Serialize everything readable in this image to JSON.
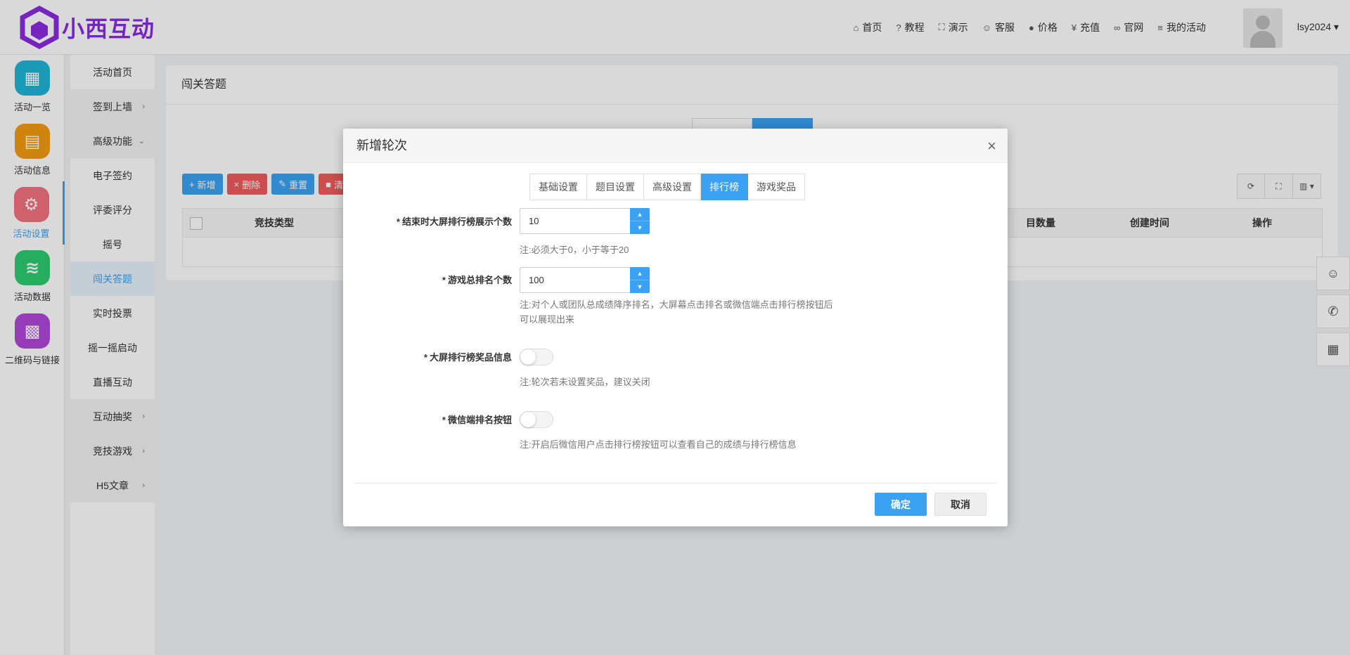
{
  "brand": {
    "name": "小西互动",
    "color": "#8a2be2"
  },
  "topnav": [
    {
      "icon": "⌂",
      "label": "首页",
      "icon_name": "home-icon"
    },
    {
      "icon": "?",
      "label": "教程",
      "icon_name": "help-icon"
    },
    {
      "icon": "⛶",
      "label": "演示",
      "icon_name": "fullscreen-icon"
    },
    {
      "icon": "☺",
      "label": "客服",
      "icon_name": "service-icon"
    },
    {
      "icon": "●",
      "label": "价格",
      "icon_name": "price-icon"
    },
    {
      "icon": "¥",
      "label": "充值",
      "icon_name": "yen-icon"
    },
    {
      "icon": "∞",
      "label": "官网",
      "icon_name": "link-icon"
    },
    {
      "icon": "≡",
      "label": "我的活动",
      "icon_name": "list-icon"
    }
  ],
  "user": {
    "name": "lsy2024 ▾"
  },
  "iconbar": [
    {
      "label": "活动一览",
      "color": "#1fb5d6",
      "glyph": "▦"
    },
    {
      "label": "活动信息",
      "color": "#f39c12",
      "glyph": "▤"
    },
    {
      "label": "活动设置",
      "color": "#f2727e",
      "glyph": "⚙"
    },
    {
      "label": "活动数据",
      "color": "#2ecc71",
      "glyph": "≋"
    },
    {
      "label": "二维码与链接",
      "color": "#b147d9",
      "glyph": "▩"
    }
  ],
  "submenu": [
    {
      "label": "活动首页",
      "chev": ""
    },
    {
      "label": "签到上墙",
      "chev": "›"
    },
    {
      "label": "高级功能",
      "chev": "⌄"
    },
    {
      "label": "电子签约",
      "chev": ""
    },
    {
      "label": "评委评分",
      "chev": ""
    },
    {
      "label": "摇号",
      "chev": ""
    },
    {
      "label": "闯关答题",
      "chev": ""
    },
    {
      "label": "实时投票",
      "chev": ""
    },
    {
      "label": "摇一摇启动",
      "chev": ""
    },
    {
      "label": "直播互动",
      "chev": ""
    },
    {
      "label": "互动抽奖",
      "chev": "›"
    },
    {
      "label": "竞技游戏",
      "chev": "›"
    },
    {
      "label": "H5文章",
      "chev": "›"
    }
  ],
  "card": {
    "title": "闯关答题",
    "toolbar": [
      {
        "label": "新增",
        "icon": "+",
        "color": "#3aa1f3"
      },
      {
        "label": "删除",
        "icon": "×",
        "color": "#ef5b5b"
      },
      {
        "label": "重置",
        "icon": "✎",
        "color": "#3aa1f3"
      },
      {
        "label": "清",
        "icon": "■",
        "color": "#ef5b5b"
      }
    ],
    "table_headers": [
      "竞技类型",
      "目数量",
      "创建时间",
      "操作"
    ]
  },
  "modal": {
    "title": "新增轮次",
    "close": "×",
    "tabs": [
      "基础设置",
      "题目设置",
      "高级设置",
      "排行榜",
      "游戏奖品"
    ],
    "active_tab": 3,
    "fields": {
      "rank_display": {
        "label": "结束时大屏排行榜展示个数",
        "value": "10",
        "note": "注:必须大于0，小于等于20"
      },
      "rank_total": {
        "label": "游戏总排名个数",
        "value": "100",
        "note": "注:对个人或团队总成绩降序排名，大屏幕点击排名或微信端点击排行榜按钮后可以展现出来"
      },
      "rank_prize": {
        "label": "大屏排行榜奖品信息",
        "enabled": false,
        "note": "注:轮次若未设置奖品，建议关闭"
      },
      "wechat_rank_btn": {
        "label": "微信端排名按钮",
        "enabled": false,
        "note": "注:开启后微信用户点击排行榜按钮可以查看自己的成绩与排行榜信息"
      }
    },
    "ok": "确定",
    "cancel": "取消"
  }
}
